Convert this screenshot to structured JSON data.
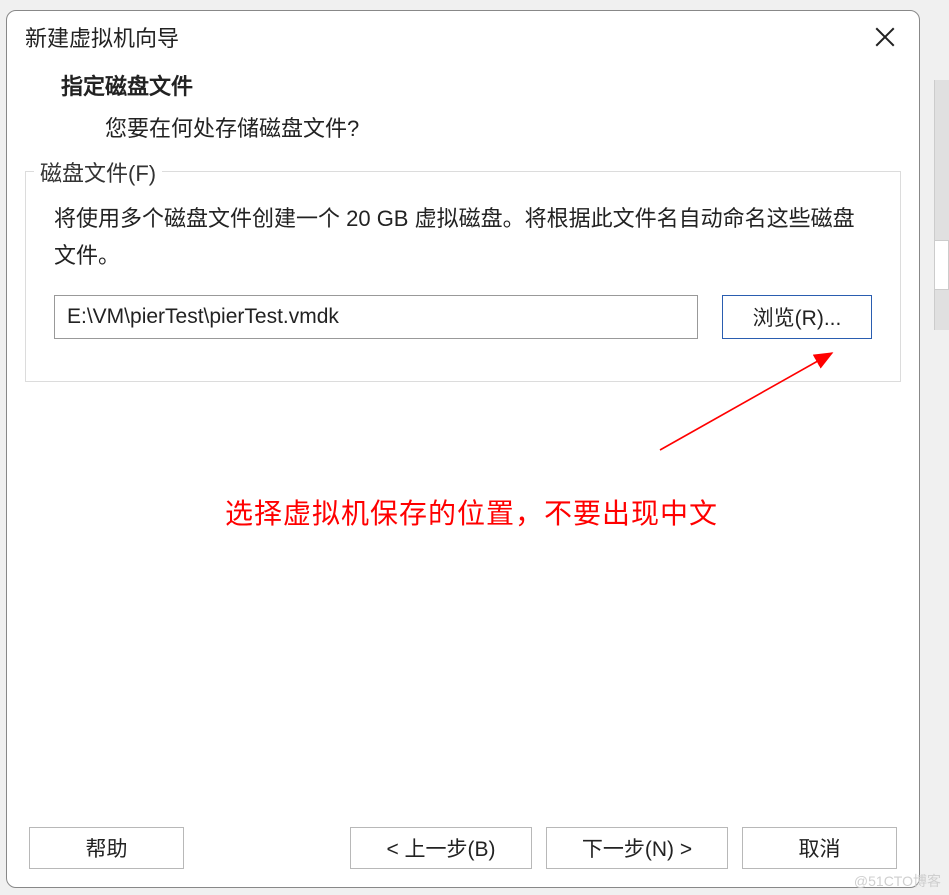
{
  "dialog": {
    "title": "新建虚拟机向导"
  },
  "header": {
    "heading": "指定磁盘文件",
    "sub": "您要在何处存储磁盘文件?"
  },
  "fieldset": {
    "legend": "磁盘文件(F)",
    "description": "将使用多个磁盘文件创建一个 20 GB 虚拟磁盘。将根据此文件名自动命名这些磁盘文件。",
    "path_value": "E:\\VM\\pierTest\\pierTest.vmdk",
    "browse_label": "浏览(R)..."
  },
  "annotation": {
    "text": "选择虚拟机保存的位置，不要出现中文"
  },
  "footer": {
    "help_label": "帮助",
    "back_label": "< 上一步(B)",
    "next_label": "下一步(N) >",
    "cancel_label": "取消"
  },
  "watermark": "@51CTO博客"
}
